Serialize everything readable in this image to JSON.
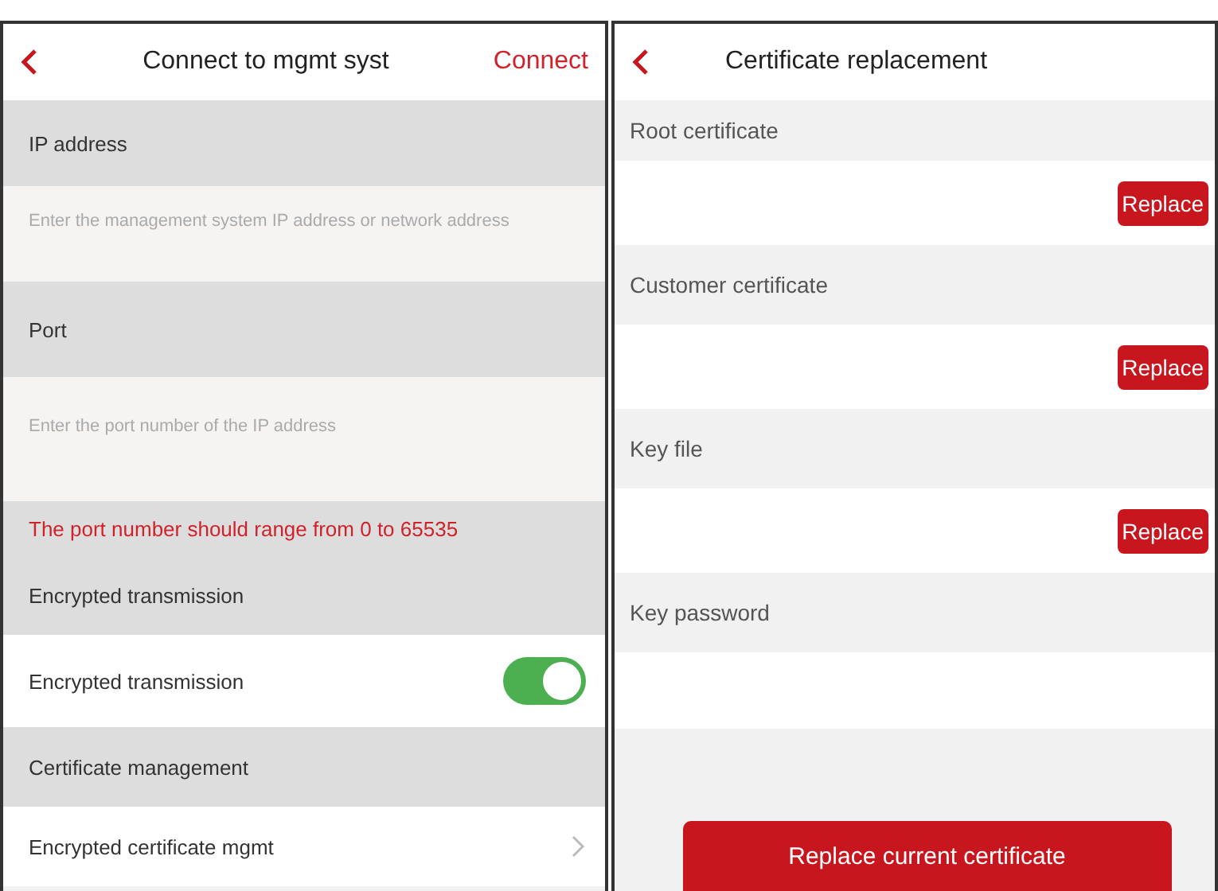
{
  "left": {
    "title": "Connect to mgmt syst",
    "action": "Connect",
    "items": [
      {
        "kind": "section",
        "label": "IP address"
      },
      {
        "kind": "input",
        "placeholder": "Enter the management system IP address or network address"
      },
      {
        "kind": "section",
        "label": "Port"
      },
      {
        "kind": "input",
        "placeholder": "Enter the port number of the IP address"
      },
      {
        "kind": "error",
        "label": "The port number should range from 0 to 65535"
      },
      {
        "kind": "section",
        "label": "Encrypted transmission"
      },
      {
        "kind": "toggle",
        "label": "Encrypted transmission",
        "on": true
      },
      {
        "kind": "section",
        "label": "Certificate management"
      },
      {
        "kind": "link",
        "label": "Encrypted certificate mgmt"
      }
    ]
  },
  "right": {
    "title": "Certificate replacement",
    "items": [
      {
        "kind": "label",
        "label": "Root certificate"
      },
      {
        "kind": "file",
        "button": "Replace"
      },
      {
        "kind": "label",
        "label": "Customer certificate"
      },
      {
        "kind": "file",
        "button": "Replace"
      },
      {
        "kind": "label",
        "label": "Key file"
      },
      {
        "kind": "file",
        "button": "Replace"
      },
      {
        "kind": "label",
        "label": "Key password"
      },
      {
        "kind": "password"
      }
    ],
    "submit": "Replace current certificate"
  }
}
